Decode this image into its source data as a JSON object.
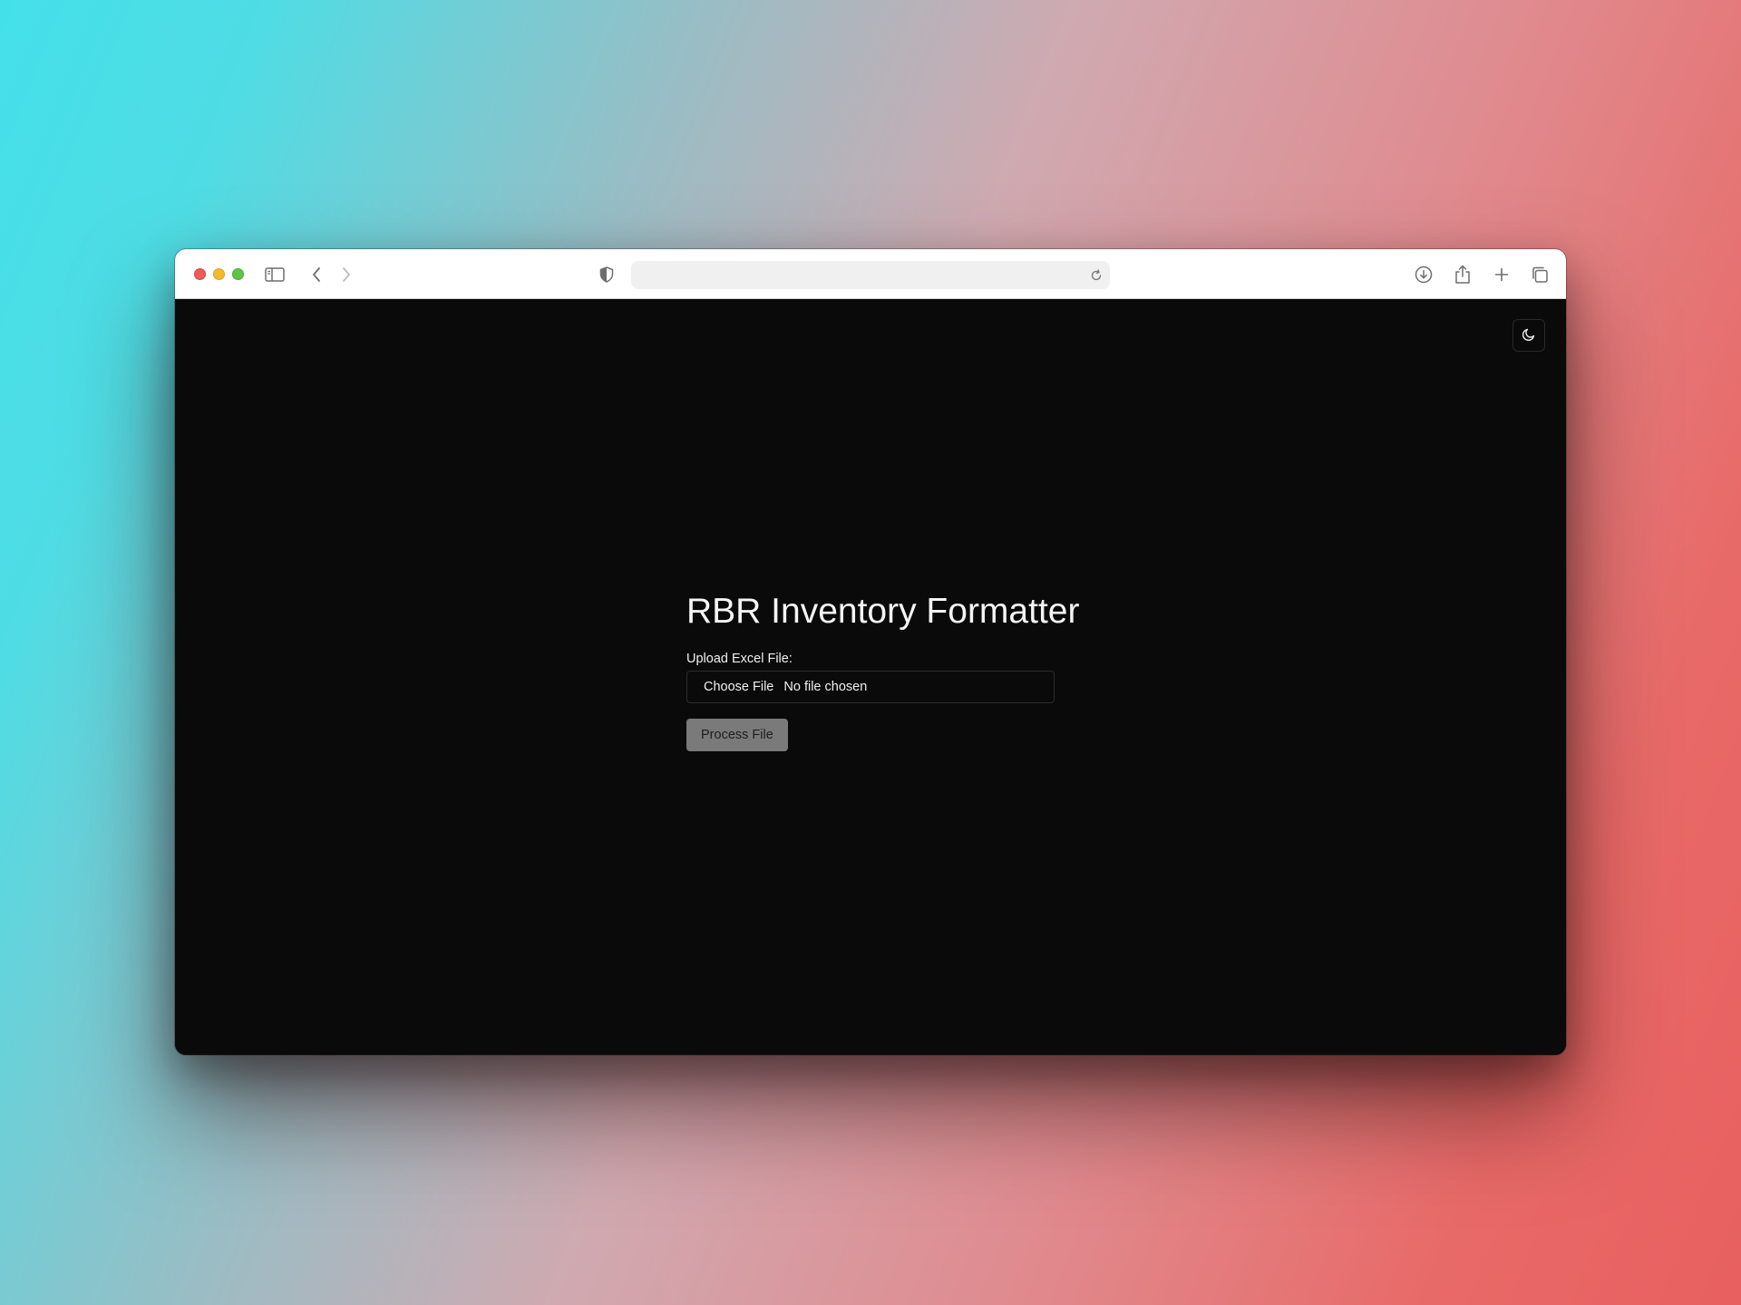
{
  "browser": {
    "address_bar": {
      "url": ""
    },
    "icons": {
      "sidebar": "sidebar-icon",
      "back": "chevron-left-icon",
      "forward": "chevron-right-icon",
      "privacy": "shield-icon",
      "reload": "reload-icon",
      "download": "download-icon",
      "share": "share-icon",
      "new_tab": "plus-icon",
      "tabs": "tabs-overview-icon"
    }
  },
  "page": {
    "theme_toggle_icon": "moon-icon",
    "title": "RBR Inventory Formatter",
    "upload_label": "Upload Excel File:",
    "file_input": {
      "button_label": "Choose File",
      "status": "No file chosen"
    },
    "process_button_label": "Process File"
  },
  "colors": {
    "page_background": "#0a0a0a",
    "process_button_bg": "#7a7a7a",
    "toolbar_background": "#ffffff"
  }
}
